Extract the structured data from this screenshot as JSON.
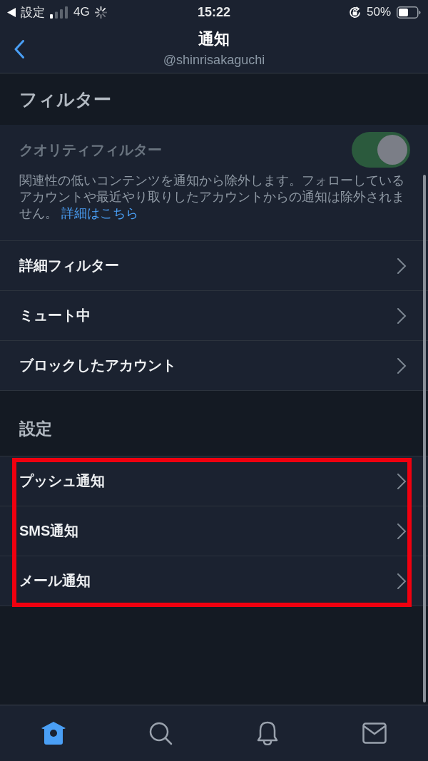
{
  "status_bar": {
    "back_label": "設定",
    "network": "4G",
    "time": "15:22",
    "battery": "50%"
  },
  "header": {
    "title": "通知",
    "subtitle": "@shinrisakaguchi"
  },
  "sections": [
    {
      "title": "フィルター",
      "items": [
        {
          "kind": "toggle",
          "label": "クオリティフィルター",
          "on": true,
          "disabled": true,
          "description": "関連性の低いコンテンツを通知から除外します。フォローしているアカウントや最近やり取りしたアカウントからの通知は除外されません。",
          "link": "詳細はこちら"
        },
        {
          "kind": "link",
          "label": "詳細フィルター"
        },
        {
          "kind": "link",
          "label": "ミュート中"
        },
        {
          "kind": "link",
          "label": "ブロックしたアカウント"
        }
      ]
    },
    {
      "title": "設定",
      "highlighted": true,
      "items": [
        {
          "kind": "link",
          "label": "プッシュ通知"
        },
        {
          "kind": "link",
          "label": "SMS通知"
        },
        {
          "kind": "link",
          "label": "メール通知"
        }
      ]
    }
  ],
  "tab_bar": {
    "tabs": [
      {
        "selected": true
      },
      {
        "selected": false
      },
      {
        "selected": false
      },
      {
        "selected": false
      }
    ]
  }
}
